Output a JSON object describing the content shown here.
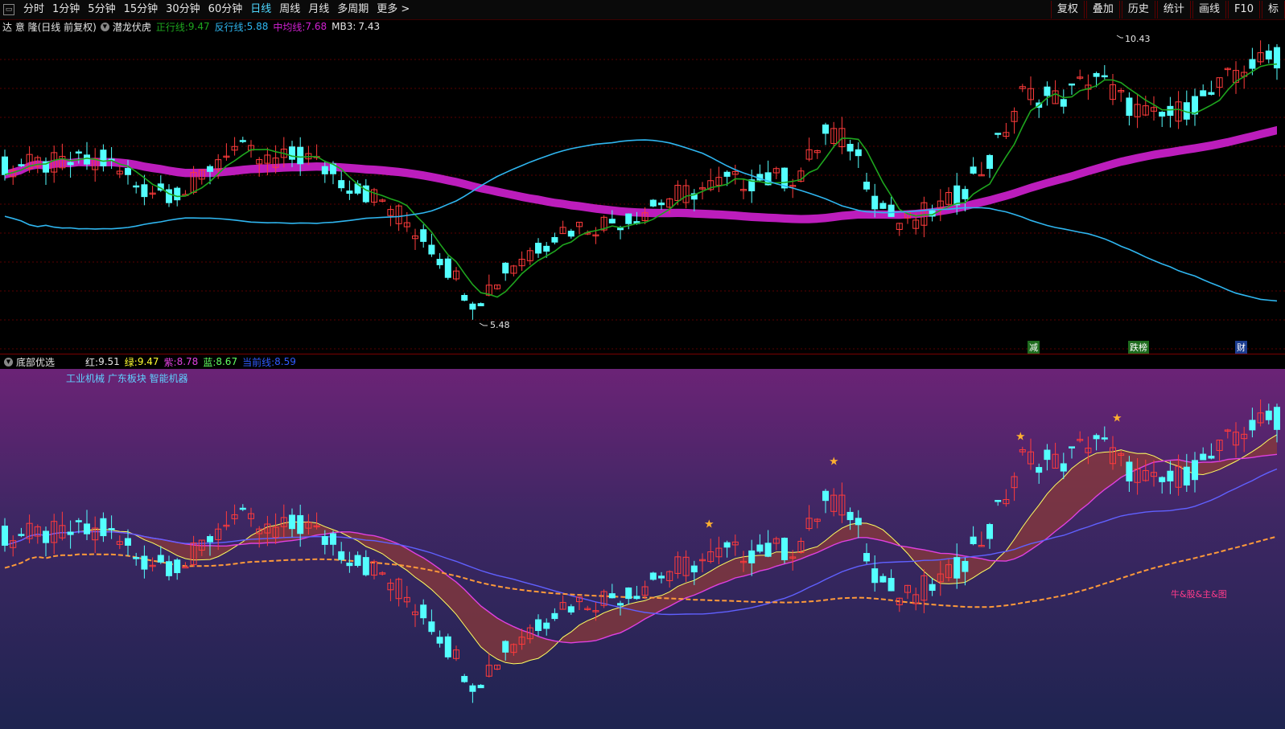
{
  "toolbar": {
    "periods": [
      "分时",
      "1分钟",
      "5分钟",
      "15分钟",
      "30分钟",
      "60分钟",
      "日线",
      "周线",
      "月线",
      "多周期",
      "更多 >"
    ],
    "active_period": "日线",
    "right_buttons": [
      "复权",
      "叠加",
      "历史",
      "统计",
      "画线",
      "F10",
      "标"
    ]
  },
  "main_info": {
    "stock": "达 意 隆(日线 前复权)",
    "indicator": "潜龙伏虎",
    "zheng_label": "正行线:",
    "zheng_value": "9.47",
    "fan_label": "反行线:",
    "fan_value": "5.88",
    "zhong_label": "中均线:",
    "zhong_value": "7.68",
    "mb3_label": "MB3:",
    "mb3_value": "7.43"
  },
  "main_chart": {
    "high_label": "10.43",
    "low_label": "5.48",
    "badges": [
      "减",
      "跌榜",
      "财"
    ]
  },
  "sub_info": {
    "indicator": "底部优选",
    "red_label": "红:",
    "red_value": "9.51",
    "green_label": "绿:",
    "green_value": "9.47",
    "purple_label": "紫:",
    "purple_value": "8.78",
    "blue_label": "蓝:",
    "blue_value": "8.67",
    "cost_label": "当前线:",
    "cost_value": "8.59",
    "tags": "工业机械 广东板块 智能机器",
    "annotation": "牛&股&主&图"
  },
  "colors": {
    "up": "#ff3b3b",
    "down": "#54ffff",
    "green_line": "#1ea51e",
    "blue_line": "#2fb6f0",
    "magenta": "#d020d0",
    "accent": "#4fd7ff"
  }
}
